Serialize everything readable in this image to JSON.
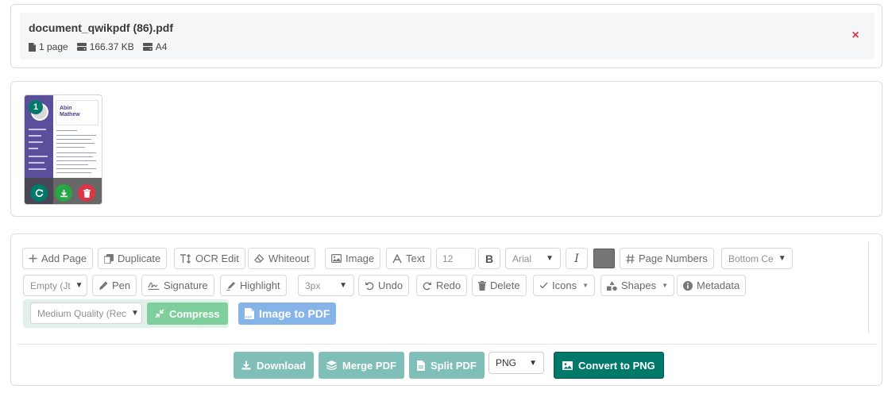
{
  "file": {
    "name": "document_qwikpdf (86).pdf",
    "pages": "1 page",
    "size": "166.37 KB",
    "paper": "A4",
    "close_symbol": "×"
  },
  "thumbnail": {
    "page_number": "1",
    "preview_first_name": "Abin",
    "preview_last_name": "Mathew"
  },
  "toolbar": {
    "add_page": "Add Page",
    "duplicate": "Duplicate",
    "ocr_edit": "OCR Edit",
    "whiteout": "Whiteout",
    "image": "Image",
    "text": "Text",
    "font_size": "12",
    "bold": "B",
    "font_family": "Arial",
    "italic": "I",
    "text_color": "#757575",
    "page_numbers": "Page Numbers",
    "page_number_position": "Bottom Ce",
    "page_number_format": "Empty (Jt",
    "pen": "Pen",
    "signature": "Signature",
    "highlight": "Highlight",
    "stroke_size": "3px",
    "undo": "Undo",
    "redo": "Redo",
    "delete": "Delete",
    "icons": "Icons",
    "shapes": "Shapes",
    "metadata": "Metadata",
    "quality": "Medium Quality (Rec",
    "compress": "Compress",
    "image_to_pdf": "Image to PDF"
  },
  "actions": {
    "download": "Download",
    "merge": "Merge PDF",
    "split": "Split PDF",
    "format": "PNG",
    "convert": "Convert to PNG"
  },
  "colors": {
    "accent": "#00796b",
    "danger": "#dc3545",
    "success": "#28a745"
  }
}
